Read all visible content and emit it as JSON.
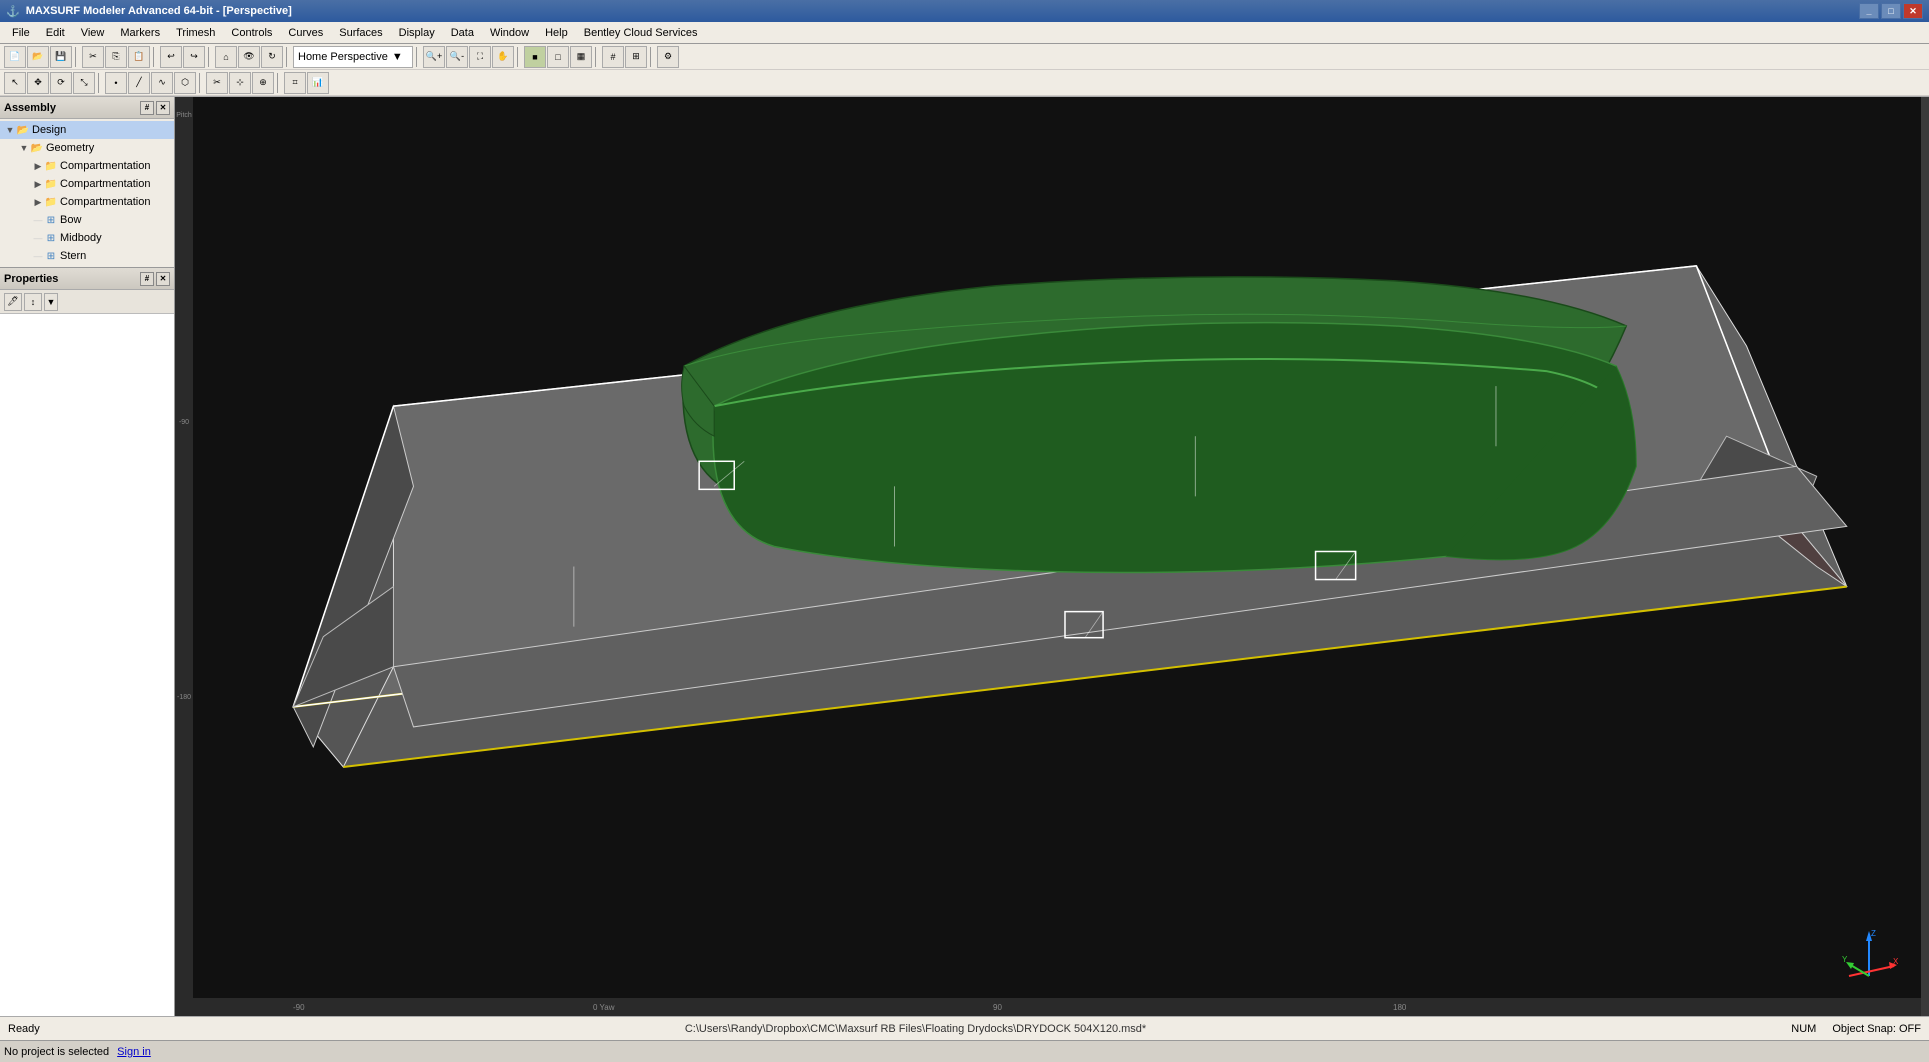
{
  "titleBar": {
    "title": "MAXSURF Modeler Advanced 64-bit - [Perspective]",
    "controls": [
      "minimize",
      "maximize",
      "close"
    ]
  },
  "menuBar": {
    "items": [
      "File",
      "Edit",
      "View",
      "Markers",
      "Trimesh",
      "Controls",
      "Curves",
      "Surfaces",
      "Display",
      "Data",
      "Window",
      "Help",
      "Bentley Cloud Services"
    ]
  },
  "toolbar": {
    "viewport_label": "Home Perspective",
    "dropdown_arrow": "▼"
  },
  "assembly": {
    "title": "Assembly",
    "tree": [
      {
        "label": "Design",
        "type": "folder",
        "level": 0,
        "expanded": true
      },
      {
        "label": "Geometry",
        "type": "folder",
        "level": 1,
        "expanded": true
      },
      {
        "label": "Compartmentation",
        "type": "folder",
        "level": 2,
        "expanded": false
      },
      {
        "label": "Compartmentation",
        "type": "folder",
        "level": 2,
        "expanded": false
      },
      {
        "label": "Compartmentation",
        "type": "folder",
        "level": 2,
        "expanded": false
      },
      {
        "label": "Bow",
        "type": "item",
        "level": 2
      },
      {
        "label": "Midbody",
        "type": "item",
        "level": 2
      },
      {
        "label": "Stern",
        "type": "item",
        "level": 2
      }
    ]
  },
  "properties": {
    "title": "Properties"
  },
  "viewport": {
    "label": "Home Perspective"
  },
  "statusBar": {
    "ready": "Ready",
    "filePath": "C:\\Users\\Randy\\Dropbox\\CMC\\Maxsurf RB Files\\Floating Drydocks\\DRYDOCK 504X120.msd*",
    "numLock": "NUM",
    "objectSnap": "Object Snap: OFF"
  },
  "bottomBar": {
    "noProject": "No project is selected",
    "signIn": "Sign in"
  },
  "rulers": {
    "left_marks": [
      "-90",
      "-180",
      "Pitch"
    ],
    "bottom_marks": [
      "-90",
      "0 Yaw",
      "90",
      "180"
    ]
  }
}
